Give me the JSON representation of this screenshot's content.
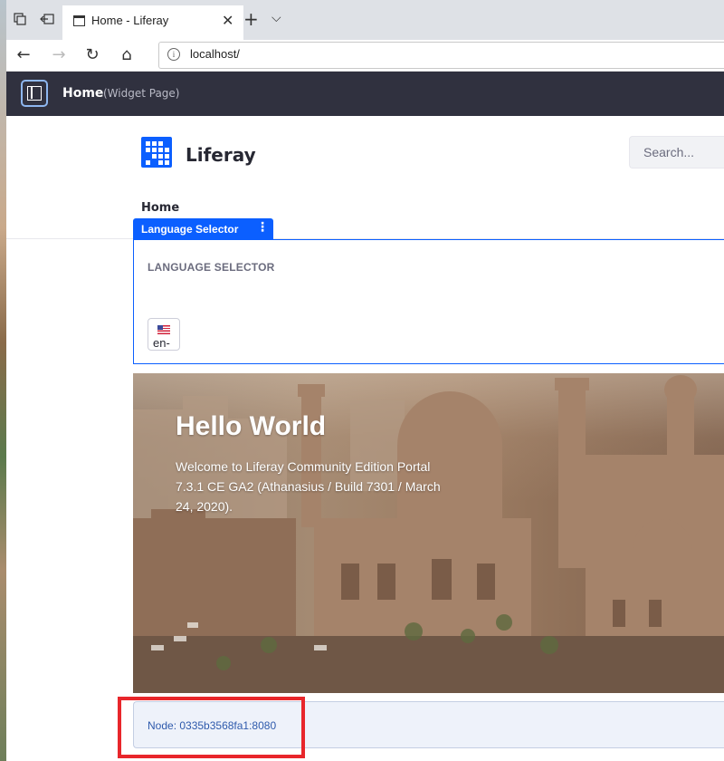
{
  "browser": {
    "tab_title": "Home - Liferay",
    "address": "localhost/",
    "icons": {
      "tab_actions": "tab-actions-icon",
      "set_aside": "set-aside-tabs-icon",
      "new_tab": "+",
      "tab_menu": "⌵",
      "back": "←",
      "forward": "→",
      "refresh": "↻",
      "home": "⌂",
      "close": "✕",
      "info": "i"
    }
  },
  "control_menu": {
    "title": "Home",
    "subtitle": "(Widget Page)"
  },
  "site": {
    "name": "Liferay",
    "search_placeholder": "Search...",
    "nav_home": "Home"
  },
  "portlet": {
    "tab_label": "Language Selector",
    "kebab": "⋮",
    "title": "LANGUAGE SELECTOR",
    "language_code": "en-"
  },
  "banner": {
    "heading": "Hello World",
    "text": "Welcome to Liferay Community Edition Portal 7.3.1 CE GA2 (Athanasius / Build 7301 / March 24, 2020)."
  },
  "footer": {
    "node": "Node: 0335b3568fa1:8080"
  },
  "colors": {
    "control_menu_bg": "#30313f",
    "primary": "#0b5fff",
    "highlight": "#e8262b"
  }
}
